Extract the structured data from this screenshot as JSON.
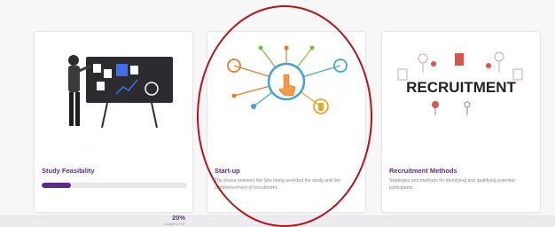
{
  "cards": [
    {
      "title": "Study Feasibility",
      "progress": 20,
      "percent_text": "20%",
      "percent_label": "COMPLETE"
    },
    {
      "title": "Start-up",
      "description": "The phase between the Site being awarded the study until the commencement of recruitment."
    },
    {
      "title": "Recruitment Methods",
      "description": "Strategies and methods for identifying and qualifying potential participants.",
      "illustration_text": "RECRUITMENT"
    }
  ],
  "colors": {
    "accent": "#5b2c83",
    "highlight": "#b5121b"
  }
}
